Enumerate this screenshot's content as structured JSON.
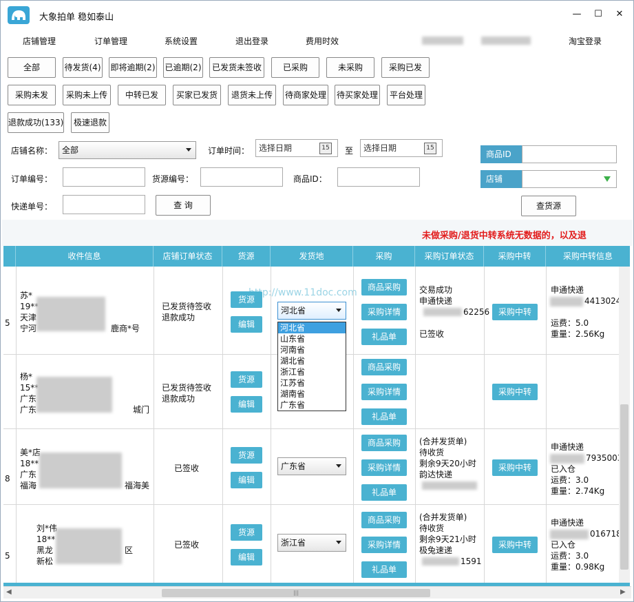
{
  "app": {
    "title": "大象拍单  稳如泰山"
  },
  "window_controls": {
    "minimize": "—",
    "maximize": "☐",
    "close": "✕"
  },
  "menu": {
    "items": [
      "店铺管理",
      "订单管理",
      "系统设置",
      "退出登录",
      "费用时效"
    ],
    "taobao_login": "淘宝登录"
  },
  "filters": {
    "row1": [
      "全部",
      "待发货(4)",
      "即将逾期(2)",
      "已逾期(2)",
      "已发货未签收",
      "已采购",
      "未采购",
      "采购已发"
    ],
    "row2": [
      "采购未发",
      "采购未上传",
      "中转已发",
      "买家已发货",
      "退货未上传",
      "待商家处理",
      "待买家处理",
      "平台处理"
    ],
    "row3": [
      "退款成功(133)",
      "极速退款"
    ]
  },
  "form": {
    "shop_name_label": "店铺名称：",
    "shop_name_value": "全部",
    "order_time_label": "订单时间：",
    "date_placeholder": "选择日期",
    "date_to": "至",
    "calendar_day": "15",
    "order_no_label": "订单编号：",
    "source_no_label": "货源编号：",
    "product_id_label": "商品ID：",
    "express_no_label": "快递单号：",
    "query_button": "查  询",
    "right_product_id": "商品ID",
    "right_shop": "店铺",
    "find_source_button": "查货源"
  },
  "warning": "未做采购/退货中转系统无数据的，以及退",
  "watermark": "http://www.11doc.com",
  "table": {
    "headers": [
      "收件信息",
      "店铺订单状态",
      "货源",
      "发货地",
      "采购",
      "采购订单状态",
      "采购中转",
      "采购中转信息"
    ],
    "buttons": {
      "source": "货源",
      "edit": "编辑",
      "product_purchase": "商品采购",
      "purchase_detail": "采购详情",
      "gift": "礼品单",
      "transfer": "采购中转"
    },
    "rows": [
      {
        "idx": "5",
        "recipient": [
          "苏*",
          "19***",
          "天津",
          "宁河"
        ],
        "recipient_tail": "鹿商*号",
        "status": [
          "已发货待签收",
          "退款成功"
        ],
        "ship_from": "河北省",
        "purchase_status": [
          "交易成功",
          "申通快递",
          "",
          "已签收"
        ],
        "purchase_num_tail": "62256",
        "transfer_info": [
          "申通快递",
          "",
          "运费：5.0",
          "重量：2.56Kg"
        ],
        "transfer_num_tail": "4413024"
      },
      {
        "idx": "",
        "recipient": [
          "杨*",
          "15**",
          "广东",
          "广东"
        ],
        "recipient_tail": "城门",
        "status": [
          "已发货待签收",
          "退款成功"
        ],
        "ship_from": "",
        "purchase_status": [],
        "purchase_num_tail": "",
        "transfer_info": [],
        "transfer_num_tail": ""
      },
      {
        "idx": "8",
        "recipient": [
          "美*店",
          "18**",
          "广东",
          "福海"
        ],
        "recipient_tail": "福海美",
        "status": [
          "已签收"
        ],
        "ship_from": "广东省",
        "purchase_status": [
          "(合并发货单)",
          "待收货",
          "剩余9天20小时",
          "韵达快递"
        ],
        "purchase_num_tail": "",
        "transfer_info": [
          "申通快递",
          "已入仓",
          "运费：3.0",
          "重量：2.74Kg"
        ],
        "transfer_num_tail": "7935003"
      },
      {
        "idx": "5",
        "recipient": [
          "刘*伟",
          "18**",
          "黑龙",
          "新松"
        ],
        "recipient_tail": "区",
        "status": [
          "已签收"
        ],
        "ship_from": "浙江省",
        "purchase_status": [
          "(合并发货单)",
          "待收货",
          "剩余9天21小时",
          "极兔速递"
        ],
        "purchase_num_tail": "1591",
        "transfer_info": [
          "申通快递",
          "已入仓",
          "运费：3.0",
          "重量：0.98Kg"
        ],
        "transfer_num_tail": "016718"
      }
    ]
  },
  "province_dropdown": [
    "河北省",
    "山东省",
    "河南省",
    "湖北省",
    "浙江省",
    "江苏省",
    "湖南省",
    "广东省"
  ],
  "scroll": {
    "grip": "|||"
  }
}
